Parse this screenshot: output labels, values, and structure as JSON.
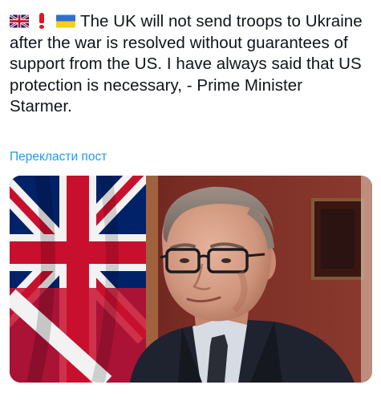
{
  "post": {
    "emoji_icons": [
      "uk-flag-icon",
      "red-exclamation-icon",
      "ukraine-flag-icon"
    ],
    "text": "The UK will not send troops to Ukraine after the war is resolved without guarantees of support from the US. I have always said that US protection is necessary, - Prime Minister Starmer.",
    "translate_label": "Перекласти пост"
  },
  "media": {
    "type": "photo",
    "subject": "man-in-glasses-and-suit-with-union-jack-flag",
    "colors": {
      "flag_red": "#c8102e",
      "flag_blue": "#012169",
      "flag_white": "#f2f2f2",
      "wall": "#6b2420",
      "suit": "#1f2330",
      "shirt": "#d7dbe4",
      "skin": "#d9a38c"
    }
  },
  "colors": {
    "text": "#0f1419",
    "link": "#1d9bf0",
    "background": "#ffffff"
  }
}
